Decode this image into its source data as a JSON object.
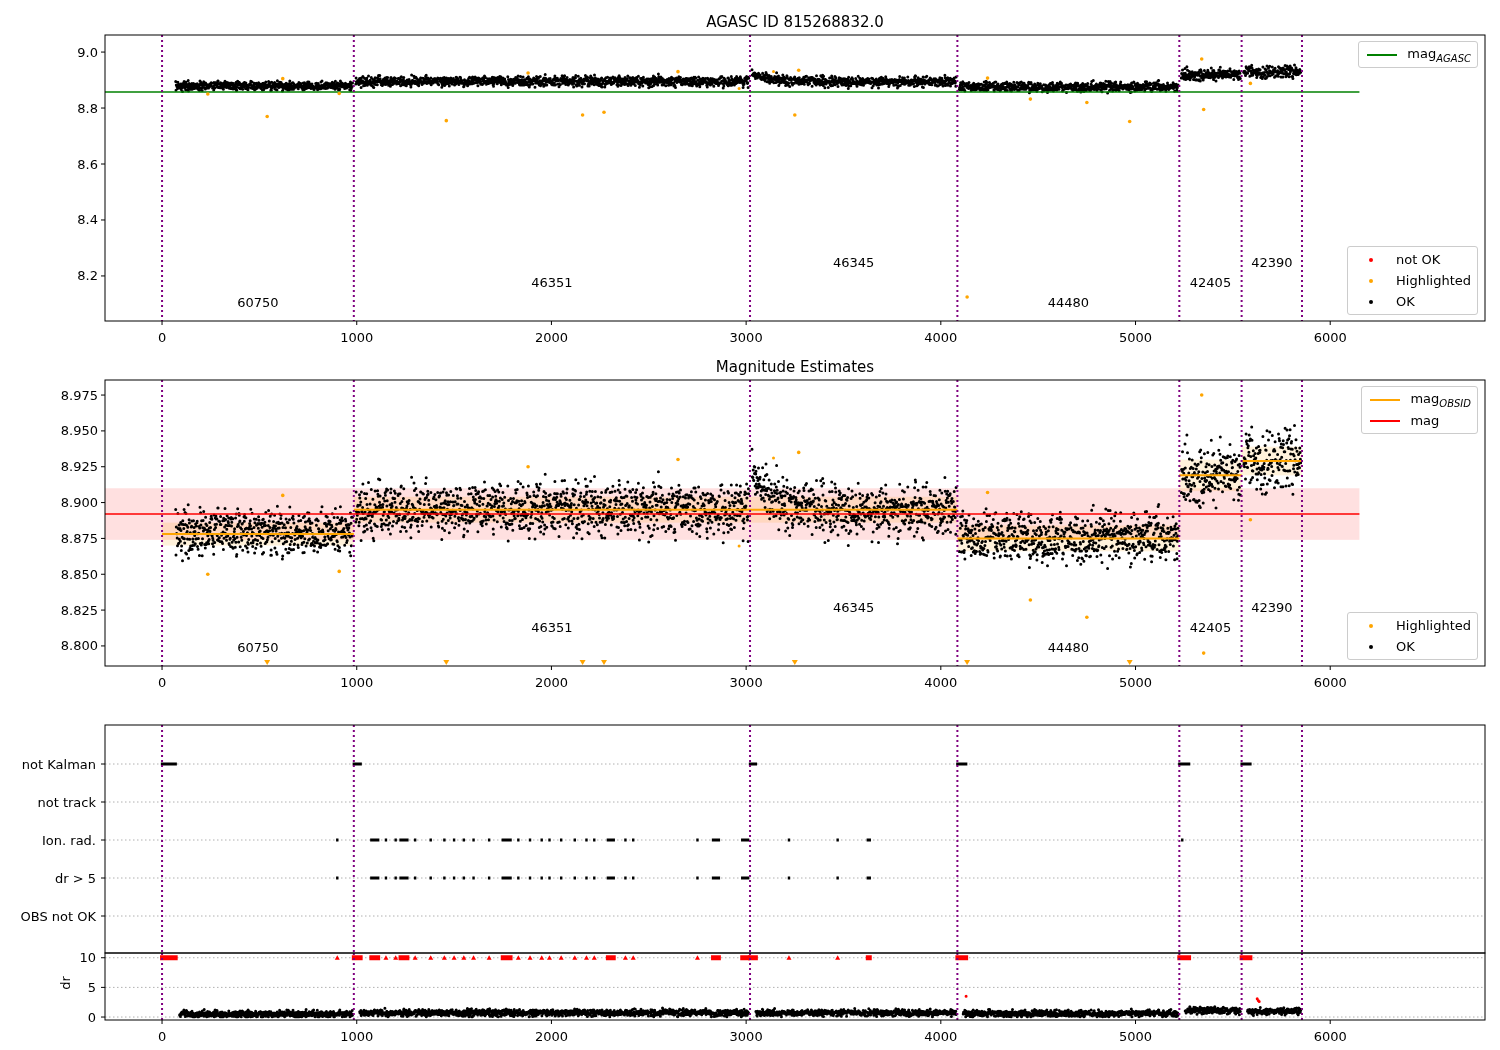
{
  "panels": [
    {
      "kind": "magnitude",
      "title": "AGASC ID 815268832.0",
      "y_tick_labels": [
        "9.0",
        "8.8",
        "8.6",
        "8.4",
        "8.2"
      ],
      "x_tick_labels": [
        "0",
        "1000",
        "2000",
        "3000",
        "4000",
        "5000",
        "6000"
      ],
      "obsid_labels": [
        "60750",
        "46351",
        "46345",
        "44480",
        "42405",
        "42390"
      ],
      "legend_upper": [
        {
          "kind": "line",
          "label": "mag$_{AGASC}$",
          "color": "#008000"
        }
      ],
      "legend_lower": [
        {
          "kind": "dot",
          "label": "not OK",
          "color": "#ff0000"
        },
        {
          "kind": "dot",
          "label": "Highlighted",
          "color": "#ffa500"
        },
        {
          "kind": "dot",
          "label": "OK",
          "color": "#000000"
        }
      ]
    },
    {
      "kind": "magnitude",
      "title": "Magnitude Estimates",
      "y_tick_labels": [
        "8.975",
        "8.950",
        "8.925",
        "8.900",
        "8.875",
        "8.850",
        "8.825",
        "8.800"
      ],
      "x_tick_labels": [
        "0",
        "1000",
        "2000",
        "3000",
        "4000",
        "5000",
        "6000"
      ],
      "obsid_labels": [
        "60750",
        "46351",
        "46345",
        "44480",
        "42405",
        "42390"
      ],
      "legend_upper": [
        {
          "kind": "line",
          "label": "mag$_{OBSID}$",
          "color": "#ffa500"
        },
        {
          "kind": "line",
          "label": "mag",
          "color": "#ff0000"
        }
      ],
      "legend_lower": [
        {
          "kind": "dot",
          "label": "Highlighted",
          "color": "#ffa500"
        },
        {
          "kind": "dot",
          "label": "OK",
          "color": "#000000"
        }
      ]
    },
    {
      "kind": "flags",
      "rows": [
        "not Kalman",
        "not track",
        "Ion. rad.",
        "dr > 5",
        "OBS not OK"
      ]
    },
    {
      "kind": "dr",
      "ylabel": "dr",
      "y_tick_labels": [
        "10",
        "5",
        "0"
      ],
      "x_tick_labels": [
        "0",
        "1000",
        "2000",
        "3000",
        "4000",
        "5000",
        "6000"
      ]
    }
  ]
}
